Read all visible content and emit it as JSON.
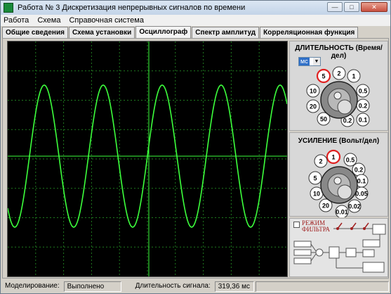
{
  "window": {
    "title": "Работа № 3     Дискретизация непрерывных сигналов по времени"
  },
  "menu": [
    "Работа",
    "Схема",
    "Справочная система"
  ],
  "tabs": [
    "Общие сведения",
    "Схема установки",
    "Осциллограф",
    "Спектр амплитуд",
    "Корреляционная функция"
  ],
  "active_tab": "Осциллограф",
  "duration": {
    "title": "ДЛИТЕЛЬНОСТЬ (Время/дел)",
    "unit": "мс",
    "settings": [
      "5",
      "2",
      "1",
      "0.5",
      "0.2",
      "0.1",
      "0.2",
      "50",
      "20",
      "10"
    ],
    "selected": "5"
  },
  "gain": {
    "title": "УСИЛЕНИЕ (Вольт/дел)",
    "settings": [
      "1",
      "0.5",
      "0.2",
      "0.1",
      "0.05",
      "0.02",
      "0.01",
      "20",
      "10",
      "5",
      "2"
    ],
    "selected": "1"
  },
  "filter": {
    "label_line1": "РЕЖИМ",
    "label_line2": "ФИЛЬТРА"
  },
  "status": {
    "modeling_label": "Моделирование:",
    "modeling_value": "Выполнено",
    "duration_label": "Длительность сигнала:",
    "duration_value": "319,36 мс"
  },
  "colors": {
    "trace": "#3cff3c",
    "grid": "#1f7a1f",
    "dial_highlight": "#e02020"
  }
}
